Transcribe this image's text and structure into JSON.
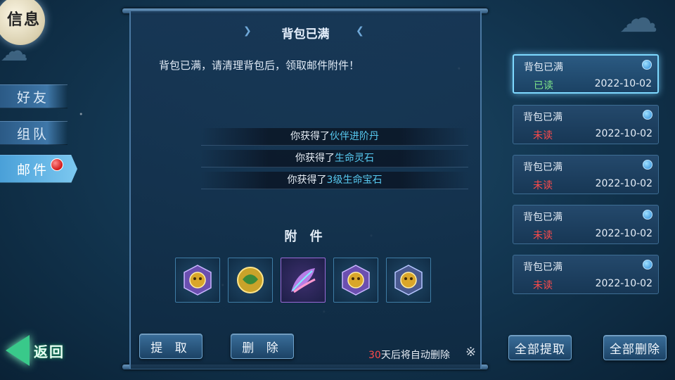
{
  "title": "信息",
  "nav": {
    "tabs": [
      {
        "label": "好友"
      },
      {
        "label": "组队"
      },
      {
        "label": "邮件"
      }
    ],
    "back_label": "返回"
  },
  "mail": {
    "title": "背包已满",
    "body": "背包已满，请清理背包后，领取邮件附件！",
    "rewards": [
      {
        "prefix": "你获得了",
        "item": "伙伴进阶丹"
      },
      {
        "prefix": "你获得了",
        "item": "生命灵石"
      },
      {
        "prefix": "你获得了",
        "item": "3级生命宝石"
      }
    ],
    "attachments_title": "附 件",
    "attachment_icons": [
      "gold-beast-gem-icon",
      "jade-orb-icon",
      "feather-icon",
      "gold-beast-gem-icon",
      "gold-beast-gem-icon"
    ],
    "claim_button": "提 取",
    "delete_button": "删 除",
    "expire_days": "30",
    "expire_text": "天后将自动删除",
    "close_symbol": "※"
  },
  "mail_list": [
    {
      "title": "背包已满",
      "status": "已读",
      "date": "2022-10-02"
    },
    {
      "title": "背包已满",
      "status": "未读",
      "date": "2022-10-02"
    },
    {
      "title": "背包已满",
      "status": "未读",
      "date": "2022-10-02"
    },
    {
      "title": "背包已满",
      "status": "未读",
      "date": "2022-10-02"
    },
    {
      "title": "背包已满",
      "status": "未读",
      "date": "2022-10-02"
    }
  ],
  "list_buttons": {
    "claim_all": "全部提取",
    "delete_all": "全部删除"
  },
  "colors": {
    "read": "#7fe58a",
    "unread": "#ff4a4a",
    "highlight": "#57c9f0"
  }
}
